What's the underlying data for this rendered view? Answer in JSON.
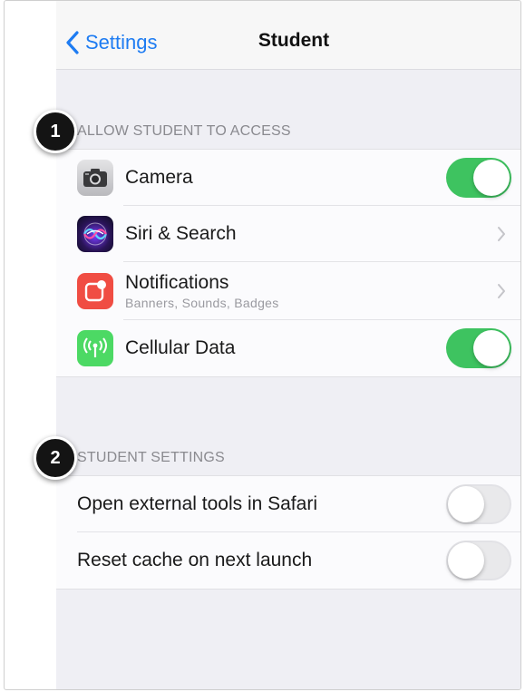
{
  "navbar": {
    "back_label": "Settings",
    "title": "Student"
  },
  "sections": [
    {
      "header": "ALLOW STUDENT TO ACCESS",
      "marker": "1",
      "rows": [
        {
          "label": "Camera",
          "control": "toggle",
          "toggle_on": true,
          "icon": "camera-icon"
        },
        {
          "label": "Siri & Search",
          "control": "chevron",
          "icon": "siri-icon"
        },
        {
          "label": "Notifications",
          "sublabel": "Banners, Sounds, Badges",
          "control": "chevron",
          "icon": "notifications-icon"
        },
        {
          "label": "Cellular Data",
          "control": "toggle",
          "toggle_on": true,
          "icon": "cellular-data-icon"
        }
      ]
    },
    {
      "header": "STUDENT SETTINGS",
      "marker": "2",
      "rows": [
        {
          "label": "Open external tools in Safari",
          "control": "toggle",
          "toggle_on": false
        },
        {
          "label": "Reset cache on next launch",
          "control": "toggle",
          "toggle_on": false
        }
      ]
    }
  ],
  "colors": {
    "accent": "#1e7cf2",
    "toggle_on": "#3ec360",
    "background": "#efeff4"
  }
}
